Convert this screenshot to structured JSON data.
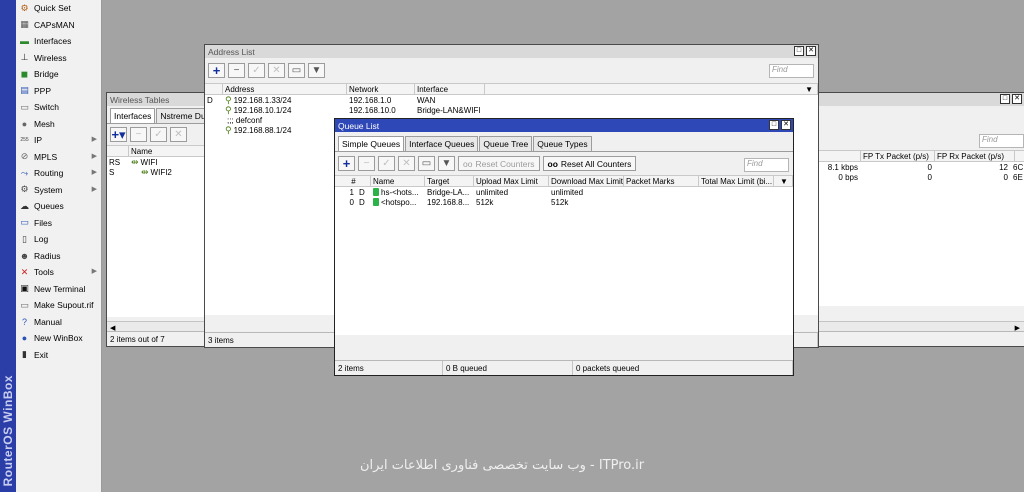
{
  "brand": "RouterOS WinBox",
  "menu": [
    {
      "label": "Quick Set",
      "icon": "quick-set-icon",
      "glyph": "⚙",
      "color": "#b05a10",
      "arrow": false
    },
    {
      "label": "CAPsMAN",
      "icon": "capsman-icon",
      "glyph": "▦",
      "color": "#555",
      "arrow": false
    },
    {
      "label": "Interfaces",
      "icon": "interfaces-icon",
      "glyph": "▬",
      "color": "#2c8a2c",
      "arrow": false
    },
    {
      "label": "Wireless",
      "icon": "wireless-icon",
      "glyph": "⊥",
      "color": "#333",
      "arrow": false
    },
    {
      "label": "Bridge",
      "icon": "bridge-icon",
      "glyph": "◼",
      "color": "#2c8a2c",
      "arrow": false
    },
    {
      "label": "PPP",
      "icon": "ppp-icon",
      "glyph": "▤",
      "color": "#2a55b5",
      "arrow": false
    },
    {
      "label": "Switch",
      "icon": "switch-icon",
      "glyph": "▭",
      "color": "#666",
      "arrow": false
    },
    {
      "label": "Mesh",
      "icon": "mesh-icon",
      "glyph": "●",
      "color": "#666",
      "arrow": false
    },
    {
      "label": "IP",
      "icon": "ip-icon",
      "glyph": "255",
      "color": "#444",
      "arrow": true
    },
    {
      "label": "MPLS",
      "icon": "mpls-icon",
      "glyph": "⊘",
      "color": "#666",
      "arrow": true
    },
    {
      "label": "Routing",
      "icon": "routing-icon",
      "glyph": "⤳",
      "color": "#2a55b5",
      "arrow": true
    },
    {
      "label": "System",
      "icon": "system-icon",
      "glyph": "⚙",
      "color": "#444",
      "arrow": true
    },
    {
      "label": "Queues",
      "icon": "queues-icon",
      "glyph": "☁",
      "color": "#333",
      "arrow": false
    },
    {
      "label": "Files",
      "icon": "files-icon",
      "glyph": "▭",
      "color": "#2a55b5",
      "arrow": false
    },
    {
      "label": "Log",
      "icon": "log-icon",
      "glyph": "▯",
      "color": "#444",
      "arrow": false
    },
    {
      "label": "Radius",
      "icon": "radius-icon",
      "glyph": "☻",
      "color": "#444",
      "arrow": false
    },
    {
      "label": "Tools",
      "icon": "tools-icon",
      "glyph": "✕",
      "color": "#c22",
      "arrow": true
    },
    {
      "label": "New Terminal",
      "icon": "terminal-icon",
      "glyph": "▣",
      "color": "#111",
      "arrow": false
    },
    {
      "label": "Make Supout.rif",
      "icon": "supout-icon",
      "glyph": "▭",
      "color": "#666",
      "arrow": false
    },
    {
      "label": "Manual",
      "icon": "manual-icon",
      "glyph": "?",
      "color": "#2a55b5",
      "arrow": false
    },
    {
      "label": "New WinBox",
      "icon": "new-winbox-icon",
      "glyph": "●",
      "color": "#2a55b5",
      "arrow": false
    },
    {
      "label": "Exit",
      "icon": "exit-icon",
      "glyph": "▮",
      "color": "#333",
      "arrow": false
    }
  ],
  "wireless": {
    "title": "Wireless Tables",
    "tabs": [
      "Interfaces",
      "Nstreme Dual"
    ],
    "col_name": "Name",
    "rows": [
      {
        "flag": "RS",
        "name": "WIFI"
      },
      {
        "flag": "S",
        "name": "WIFI2"
      }
    ],
    "status": "2 items out of 7"
  },
  "address": {
    "title": "Address List",
    "find": "Find",
    "columns": [
      "Address",
      "Network",
      "Interface"
    ],
    "rows": [
      {
        "flag": "D",
        "address": "192.168.1.33/24",
        "network": "192.168.1.0",
        "iface": "WAN",
        "comment": ""
      },
      {
        "flag": "",
        "address": "192.168.10.1/24",
        "network": "192.168.10.0",
        "iface": "Bridge-LAN&WIFI",
        "comment": ""
      },
      {
        "flag": "",
        "address": "",
        "network": "",
        "iface": "",
        "comment": ";;; defconf"
      },
      {
        "flag": "",
        "address": "192.168.88.1/24",
        "network": "",
        "iface": "",
        "comment": ""
      }
    ],
    "status": "3 items"
  },
  "right": {
    "find": "Find",
    "columns": [
      "FP Tx Packet (p/s)",
      "FP Rx Packet (p/s)"
    ],
    "rows": [
      {
        "a": "8.1 kbps",
        "b": "0",
        "c": "12",
        "d": "6C"
      },
      {
        "a": "0 bps",
        "b": "0",
        "c": "0",
        "d": "6E"
      }
    ]
  },
  "queue": {
    "title": "Queue List",
    "tabs": [
      "Simple Queues",
      "Interface Queues",
      "Queue Tree",
      "Queue Types"
    ],
    "reset_counters": "Reset Counters",
    "reset_all": "Reset All Counters",
    "find": "Find",
    "columns": [
      "#",
      "Name",
      "Target",
      "Upload Max Limit",
      "Download Max Limit",
      "Packet Marks",
      "Total Max Limit (bi..."
    ],
    "rows": [
      {
        "num": "1",
        "flag": "D",
        "name": "hs-<hots...",
        "target": "Bridge-LA...",
        "up": "unlimited",
        "down": "unlimited"
      },
      {
        "num": "0",
        "flag": "D",
        "name": "<hotspo...",
        "target": "192.168.8...",
        "up": "512k",
        "down": "512k"
      }
    ],
    "status_items": "2 items",
    "status_queued": "0 B queued",
    "status_packets": "0 packets queued"
  },
  "watermark": "ITPro.ir - وب سایت تخصصی فناوری اطلاعات ایران"
}
